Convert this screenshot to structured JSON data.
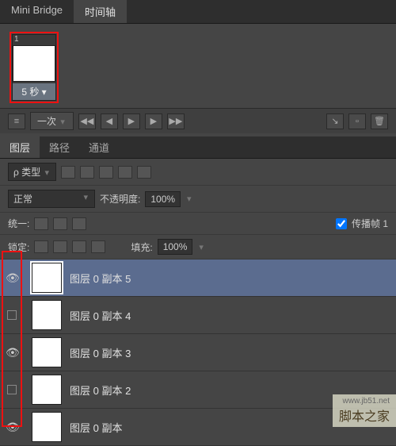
{
  "timeline": {
    "tabs": [
      "Mini Bridge",
      "时间轴"
    ],
    "active_tab": 1,
    "frame_num": "1",
    "frame_delay": "5 秒 ▾",
    "loop": "一次"
  },
  "layers_panel": {
    "tabs": [
      "图层",
      "路径",
      "通道"
    ],
    "active_tab": 0,
    "kind_search": "ρ 类型",
    "blend_mode": "正常",
    "opacity_label": "不透明度:",
    "opacity_val": "100%",
    "unify_label": "统一:",
    "propagate_label": "传播帧 1",
    "lock_label": "锁定:",
    "fill_label": "填充:",
    "fill_val": "100%"
  },
  "layers": [
    {
      "name": "图层 0 副本 5",
      "visible": true,
      "selected": true
    },
    {
      "name": "图层 0 副本 4",
      "visible": false,
      "selected": false
    },
    {
      "name": "图层 0 副本 3",
      "visible": true,
      "selected": false
    },
    {
      "name": "图层 0 副本 2",
      "visible": false,
      "selected": false
    },
    {
      "name": "图层 0 副本",
      "visible": true,
      "selected": false
    }
  ],
  "watermark": {
    "text": "脚本之家",
    "url": "www.jb51.net"
  }
}
